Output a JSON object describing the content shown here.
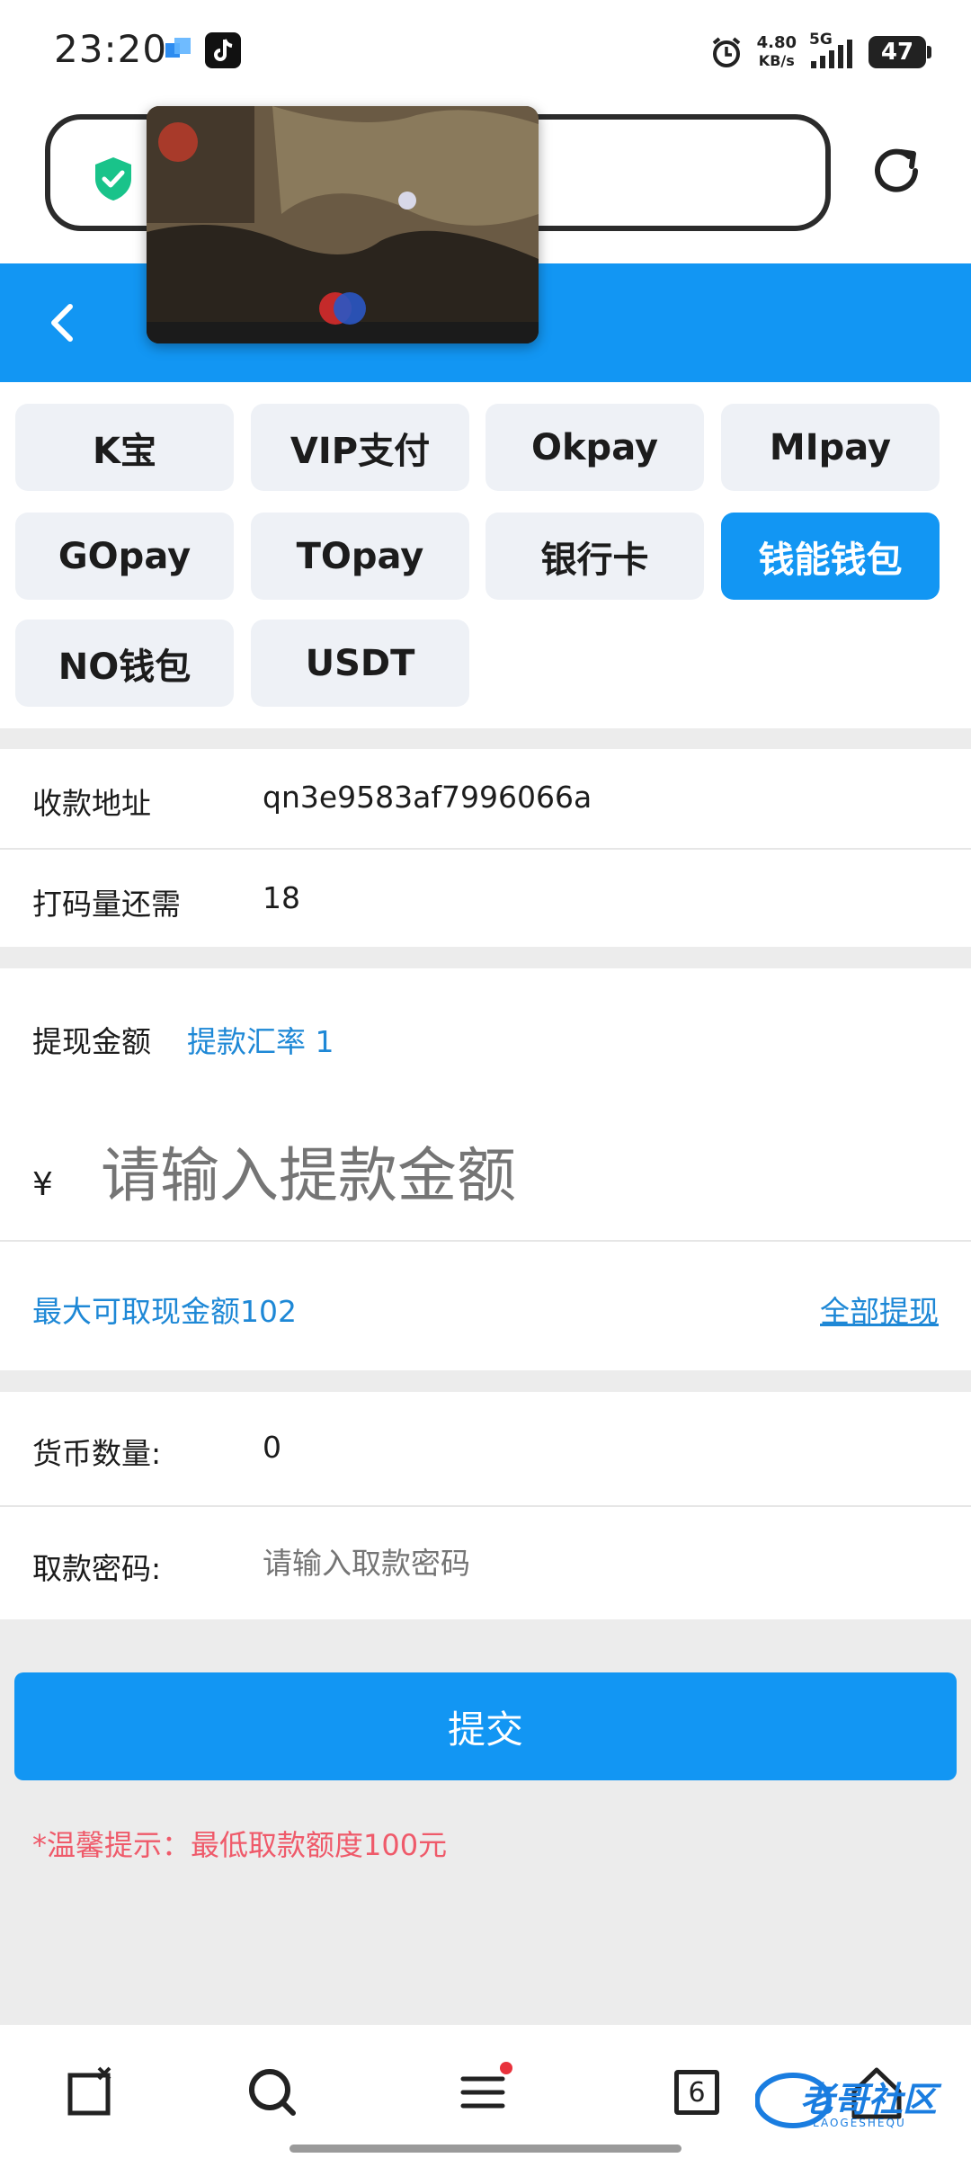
{
  "status_bar": {
    "time": "23:20",
    "net_speed_value": "4.80",
    "net_speed_unit": "KB/s",
    "network": "5G",
    "battery": "47"
  },
  "payment_methods": [
    {
      "label": "K宝",
      "active": false
    },
    {
      "label": "VIP支付",
      "active": false
    },
    {
      "label": "Okpay",
      "active": false
    },
    {
      "label": "MIpay",
      "active": false
    },
    {
      "label": "GOpay",
      "active": false
    },
    {
      "label": "TOpay",
      "active": false
    },
    {
      "label": "银行卡",
      "active": false
    },
    {
      "label": "钱能钱包",
      "active": true
    },
    {
      "label": "NO钱包",
      "active": false
    },
    {
      "label": "USDT",
      "active": false
    }
  ],
  "info": {
    "address_label": "收款地址",
    "address_value": "qn3e9583af7996066a",
    "wager_label": "打码量还需",
    "wager_value": "18"
  },
  "withdraw": {
    "amount_label": "提现金额",
    "rate_label": "提款汇率 1",
    "currency_symbol": "¥",
    "amount_placeholder": "请输入提款金额",
    "max_amount": "最大可取现金额102",
    "withdraw_all": "全部提现"
  },
  "form": {
    "coin_label": "货币数量:",
    "coin_value": "0",
    "password_label": "取款密码:",
    "password_placeholder": "请输入取款密码"
  },
  "submit_label": "提交",
  "tip": "*温馨提示：最低取款额度100元",
  "bottom_nav": {
    "tab_count": "6"
  },
  "watermark_text": "老哥社区",
  "watermark_sub": "LAOGESHEQU",
  "colors": {
    "accent": "#1296f3",
    "tip": "#ef5a6a",
    "link": "#1e88d6"
  }
}
